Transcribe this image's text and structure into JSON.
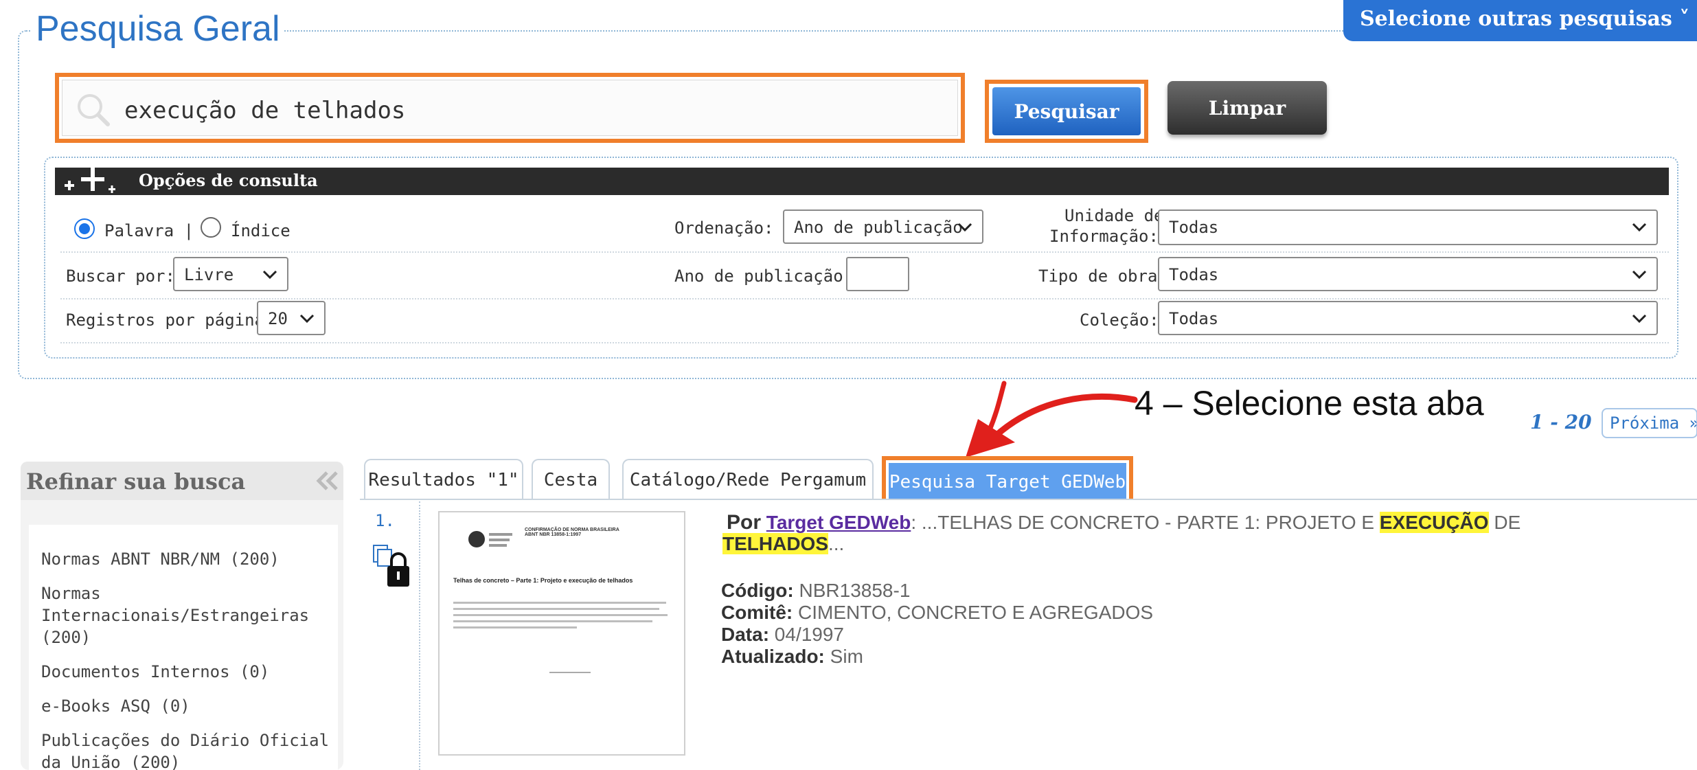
{
  "header": {
    "title": "Pesquisa Geral",
    "other_searches": "Selecione outras pesquisas ˅"
  },
  "search": {
    "query": "execução de telhados",
    "search_button": "Pesquisar",
    "clear_button": "Limpar"
  },
  "options": {
    "title": "Opções de consulta",
    "radio_word": "Palavra |",
    "radio_index": "Índice",
    "sort_label": "Ordenação:",
    "sort_value": "Ano de publicação",
    "unit_label_1": "Unidade de",
    "unit_label_2": "Informação:",
    "unit_value": "Todas",
    "search_by_label": "Buscar por:",
    "search_by_value": "Livre",
    "year_label": "Ano de publicação:",
    "year_value": "",
    "work_type_label": "Tipo de obra:",
    "work_type_value": "Todas",
    "per_page_label": "Registros por página:",
    "per_page_value": "20",
    "collection_label": "Coleção:",
    "collection_value": "Todas"
  },
  "annotation": "4 – Selecione esta aba",
  "pagination": {
    "range": "1 - 20",
    "next": "Próxima »"
  },
  "sidebar": {
    "title": "Refinar sua busca",
    "items": [
      {
        "label": "Normas ABNT NBR/NM (200)"
      },
      {
        "label": "Normas Internacionais/Estrangeiras (200)"
      },
      {
        "label": "Documentos Internos (0)"
      },
      {
        "label": "e-Books ASQ (0)"
      },
      {
        "label": "Publicações do Diário Oficial da União (200)"
      }
    ]
  },
  "tabs": {
    "results": "Resultados \"1\"",
    "basket": "Cesta",
    "catalog": "Catálogo/Rede Pergamum",
    "target": "Pesquisa Target GEDWeb"
  },
  "result": {
    "number": "1.",
    "by_label": "Por",
    "source_link": "Target GEDWeb",
    "title_prefix": ": ...TELHAS DE CONCRETO - PARTE 1: PROJETO E ",
    "hl_1": "EXECUÇÃO",
    "title_mid": " DE",
    "hl_2": "TELHADOS",
    "title_suffix": "...",
    "code_label": "Código:",
    "code_value": " NBR13858-1",
    "committee_label": "Comitê:",
    "committee_value": " CIMENTO, CONCRETO E AGREGADOS",
    "date_label": "Data:",
    "date_value": " 04/1997",
    "updated_label": "Atualizado:",
    "updated_value": " Sim",
    "thumb_header": "CONFIRMAÇÃO DE NORMA BRASILEIRA",
    "thumb_code": "ABNT NBR 13858-1:1997",
    "thumb_title": "Telhas de concreto – Parte 1: Projeto e execução de telhados"
  },
  "colors": {
    "accent_blue": "#2e74c4",
    "highlight_orange": "#f07f2b",
    "highlight_yellow": "#fff53a"
  }
}
